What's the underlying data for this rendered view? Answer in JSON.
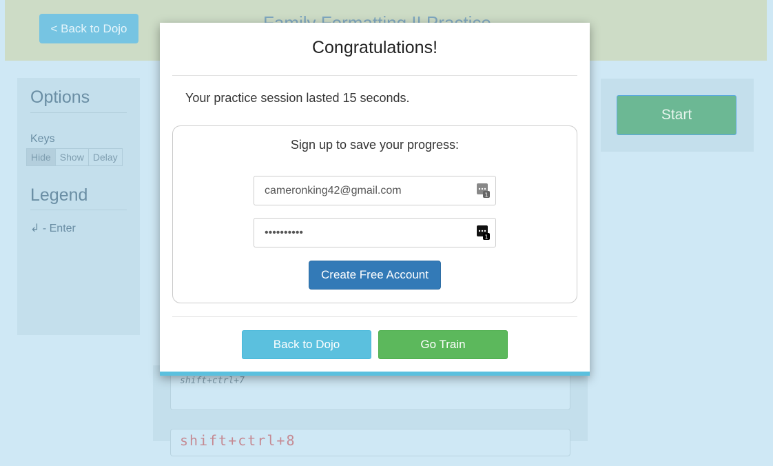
{
  "header": {
    "back_label": "< Back to Dojo",
    "title": "Family Formatting II Practice"
  },
  "sidebar": {
    "options_heading": "Options",
    "keys_label": "Keys",
    "key_modes": [
      "Hide",
      "Show",
      "Delay"
    ],
    "key_mode_selected": "Hide",
    "legend_heading": "Legend",
    "legend_items": [
      "↲ - Enter"
    ]
  },
  "controls": {
    "start_label": "Start"
  },
  "exercises": [
    "shift+ctrl+7",
    "shift+ctrl+8"
  ],
  "modal": {
    "title": "Congratulations!",
    "session_text": "Your practice session lasted 15 seconds.",
    "signup_title": "Sign up to save your progress:",
    "email_value": "cameronking42@gmail.com",
    "password_value": "••••••••••",
    "create_label": "Create Free Account",
    "back_label": "Back to Dojo",
    "train_label": "Go Train"
  },
  "colors": {
    "primary": "#337ab7",
    "info": "#5bc0de",
    "success": "#5cb85c"
  },
  "icons": {
    "field_icon": "password-manager-icon"
  }
}
